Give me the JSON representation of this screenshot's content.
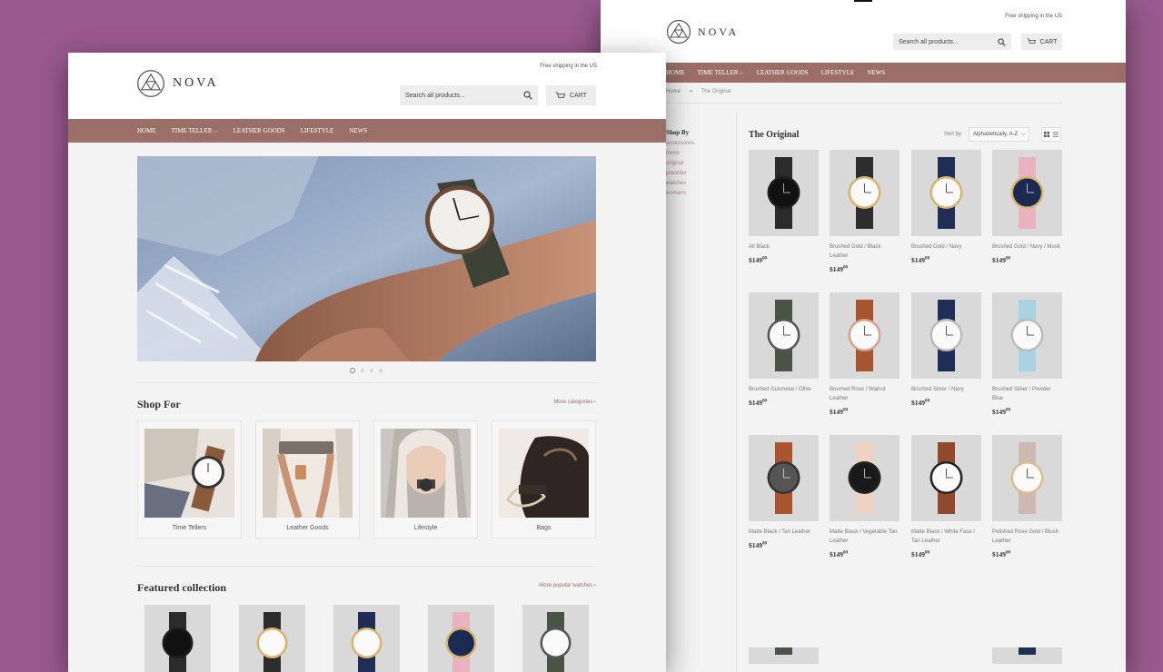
{
  "brand": {
    "name": "NOVA"
  },
  "header": {
    "shipping_note": "Free shipping in the US",
    "search_placeholder": "Search all products...",
    "cart_label": "CART"
  },
  "nav": {
    "items": [
      {
        "label": "HOME"
      },
      {
        "label": "TIME TELLER"
      },
      {
        "label": "LEATHER GOODS"
      },
      {
        "label": "LIFESTYLE"
      },
      {
        "label": "NEWS"
      }
    ]
  },
  "home": {
    "slider": {
      "slides": 4,
      "active": 1
    },
    "shop_for": {
      "title": "Shop For",
      "more_link": "More categories ›",
      "categories": [
        {
          "label": "Time Tellers"
        },
        {
          "label": "Leather Goods"
        },
        {
          "label": "Lifestyle"
        },
        {
          "label": "Bags"
        }
      ]
    },
    "featured": {
      "title": "Featured collection",
      "more_link": "More popular watches ›"
    }
  },
  "collection": {
    "breadcrumb": {
      "home": "Home",
      "separator": "»",
      "current": "The Original"
    },
    "title": "The Original",
    "sort_label": "Sort by",
    "sort_value": "Alphabetically, A-Z",
    "sidebar": {
      "title": "Shop By",
      "tags": [
        "accessories",
        "mens",
        "original",
        "preorder",
        "watches",
        "womens"
      ]
    },
    "products": [
      {
        "name": "All Black",
        "price": "$149",
        "cents": "00"
      },
      {
        "name": "Brushed Gold / Black Leather",
        "price": "$149",
        "cents": "00"
      },
      {
        "name": "Brushed Gold / Navy",
        "price": "$149",
        "cents": "00"
      },
      {
        "name": "Brushed Gold / Navy / Musk",
        "price": "$149",
        "cents": "00"
      },
      {
        "name": "Brushed Gunmetal / Olive",
        "price": "$149",
        "cents": "00"
      },
      {
        "name": "Brushed Rose / Walnut Leather",
        "price": "$149",
        "cents": "00"
      },
      {
        "name": "Brushed Silver / Navy",
        "price": "$149",
        "cents": "00"
      },
      {
        "name": "Brushed Silver / Powder Blue",
        "price": "$149",
        "cents": "00"
      },
      {
        "name": "Matte Black / Tan Leather",
        "price": "$149",
        "cents": "00"
      },
      {
        "name": "Matte Black / Vegetable Tan Leather",
        "price": "$149",
        "cents": "00"
      },
      {
        "name": "Matte Black / White Face / Tan Leather",
        "price": "$149",
        "cents": "00"
      },
      {
        "name": "Polished Rose Gold / Blush Leather",
        "price": "$149",
        "cents": "00"
      }
    ]
  },
  "colors": {
    "background": "#9a5a8f",
    "nav": "#9b6f67",
    "accent_link": "#9b6f67",
    "page": "#f3f3f3"
  }
}
